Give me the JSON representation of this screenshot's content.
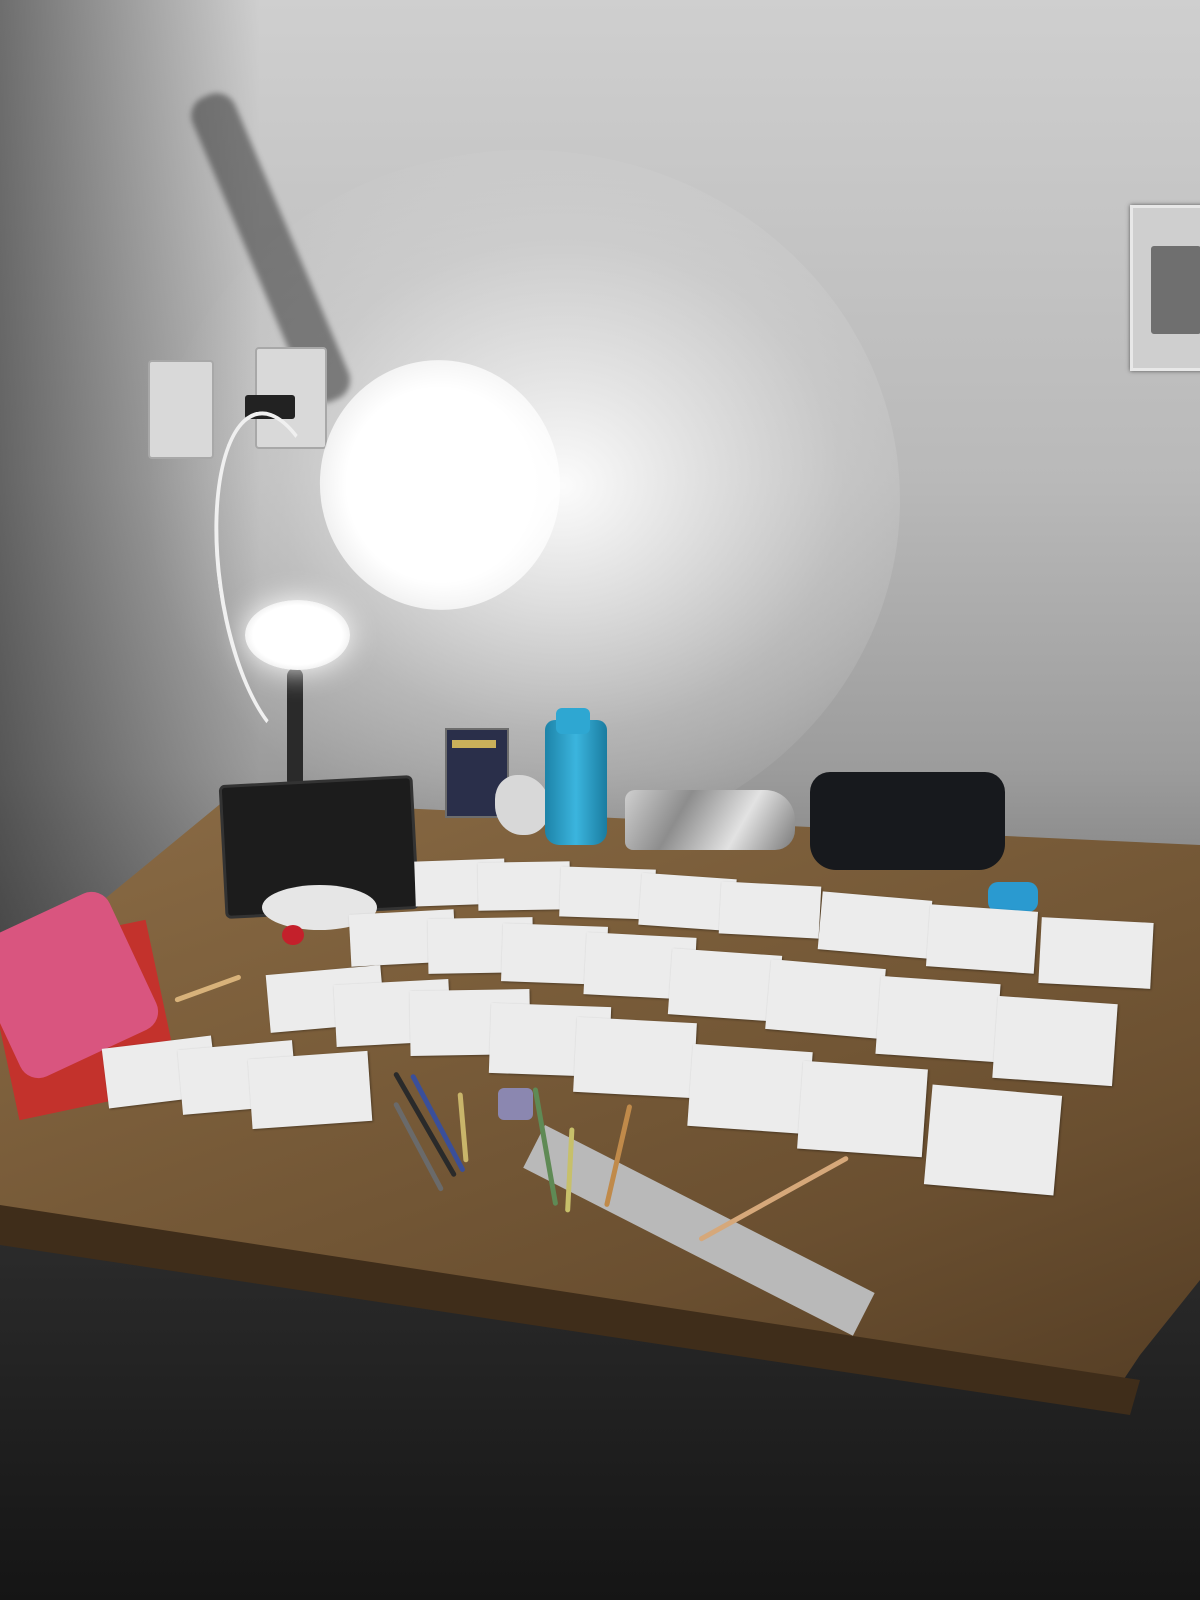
{
  "scene": {
    "description_label": "",
    "cards": [
      {
        "text": ""
      },
      {
        "text": ""
      },
      {
        "text": ""
      },
      {
        "text": ""
      },
      {
        "text": ""
      },
      {
        "text": ""
      },
      {
        "text": ""
      },
      {
        "text": ""
      },
      {
        "text": ""
      },
      {
        "text": ""
      },
      {
        "text": ""
      },
      {
        "text": ""
      },
      {
        "text": ""
      },
      {
        "text": ""
      },
      {
        "text": ""
      },
      {
        "text": ""
      },
      {
        "text": ""
      },
      {
        "text": ""
      },
      {
        "text": ""
      },
      {
        "text": ""
      },
      {
        "text": ""
      },
      {
        "text": ""
      },
      {
        "text": ""
      },
      {
        "text": ""
      },
      {
        "text": ""
      },
      {
        "text": ""
      },
      {
        "text": ""
      },
      {
        "text": ""
      },
      {
        "text": ""
      },
      {
        "text": ""
      },
      {
        "text": ""
      }
    ]
  },
  "colors": {
    "wall": "#bdbdbd",
    "desk": "#7a5d3a",
    "card": "#ececec",
    "bottle": "#2ea7d2",
    "lamp_button": "#c4202b",
    "pencil_case": "#d9557f",
    "notebook": "#c3322c"
  },
  "icons": [
    "lamp-icon",
    "bottle-icon",
    "pencil-case-icon",
    "ruler-icon"
  ]
}
